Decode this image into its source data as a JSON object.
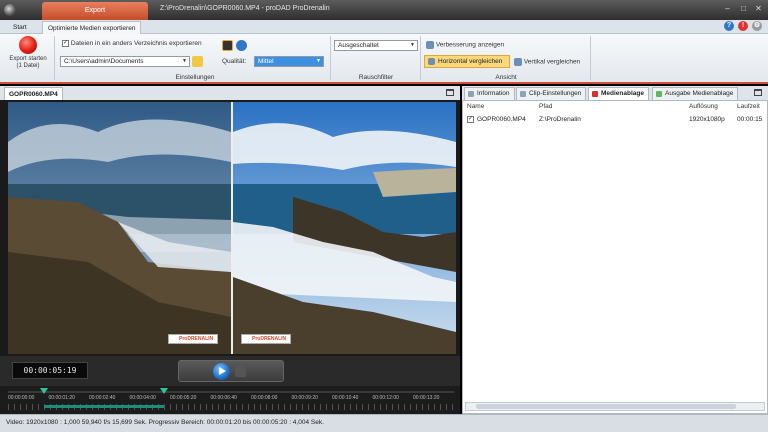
{
  "titlebar": {
    "context_tab": "Export",
    "title": "Z:\\ProDrenalin\\GOPR0060.MP4 - proDAD ProDrenalin"
  },
  "tabs": [
    {
      "label": "Start"
    },
    {
      "label": "Optimierte Medien exportieren"
    }
  ],
  "ribbon": {
    "export_label": "Export starten (1 Datei)",
    "export_other_dir_label": "Dateien in ein anders Verzeichnis exportieren",
    "export_path": "C:\\Users\\admin\\Documents",
    "quality_label": "Qualität:",
    "quality_value": "Mittel",
    "group_einstellungen": "Einstellungen",
    "denoise_value": "Ausgeschaltet",
    "group_rauschfilter": "Rauschfilter",
    "show_improvement": "Verbesserung anzeigen",
    "compare_horizontal": "Horizontal vergleichen",
    "compare_vertical": "Vertikal vergleichen",
    "group_ansicht": "Ansicht"
  },
  "video": {
    "tab_label": "GOPR0060.MP4",
    "timecode": "00:00:05:19",
    "badge_left": "ProDRENALIN",
    "badge_right": "ProDRENALIN",
    "timeline_labels": [
      "00:00:00:00",
      "00:00:01:20",
      "00:00:02:40",
      "00:00:04:00",
      "00:00:05:20",
      "00:00:06:40",
      "00:00:08:00",
      "00:00:09:20",
      "00:00:10:40",
      "00:00:12:00",
      "00:00:13:20"
    ]
  },
  "right_panel": {
    "tabs": [
      {
        "label": "Information",
        "color": "#8fa3b8"
      },
      {
        "label": "Clip-Einstellungen",
        "color": "#8fa3b8"
      },
      {
        "label": "Medienablage",
        "color": "#d9302a"
      },
      {
        "label": "Ausgabe Medienablage",
        "color": "#5cb85c"
      }
    ],
    "columns": {
      "name": "Name",
      "path": "Pfad",
      "resolution": "Auflösung",
      "duration": "Laufzeit"
    },
    "rows": [
      {
        "name": "GOPR0060.MP4",
        "path": "Z:\\ProDrenalin",
        "resolution": "1920x1080p",
        "duration": "00:00:15"
      }
    ]
  },
  "status": {
    "text": "Video: 1920x1080 : 1,000   59,940 f/s   15,699 Sek.   Progressiv   Bereich: 00:00:01:20 bis 00:00:05:20 : 4,004 Sek."
  }
}
